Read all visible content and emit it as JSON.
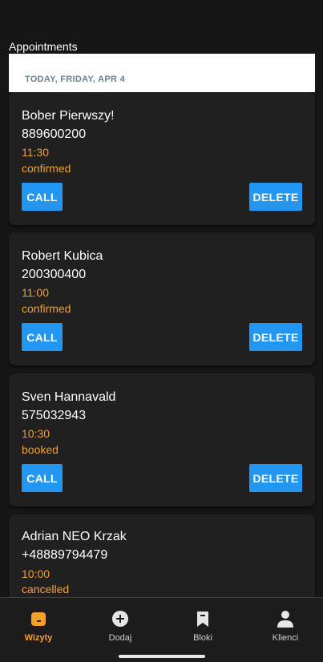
{
  "header": {
    "title": "Appointments"
  },
  "section": {
    "date_label": "TODAY, FRIDAY, APR 4"
  },
  "appointments": [
    {
      "name": "Bober Pierwszy!",
      "phone": "889600200",
      "time": "11:30",
      "status": "confirmed"
    },
    {
      "name": "Robert Kubica",
      "phone": "200300400",
      "time": "11:00",
      "status": "confirmed"
    },
    {
      "name": "Sven Hannavald",
      "phone": "575032943",
      "time": "10:30",
      "status": "booked"
    },
    {
      "name": "Adrian NEO Krzak",
      "phone": "+48889794479",
      "time": "10:00",
      "status": "cancelled"
    }
  ],
  "buttons": {
    "call": "CALL",
    "delete": "DELETE"
  },
  "tabs": [
    {
      "label": "Wizyty",
      "icon": "calendar-icon",
      "active": true
    },
    {
      "label": "Dodaj",
      "icon": "add-circle-icon",
      "active": false
    },
    {
      "label": "Bloki",
      "icon": "bookmark-icon",
      "active": false
    },
    {
      "label": "Klienci",
      "icon": "person-icon",
      "active": false
    }
  ],
  "colors": {
    "accent": "#f2a02c",
    "button": "#2196f3",
    "background": "#161616",
    "card": "#202020"
  }
}
